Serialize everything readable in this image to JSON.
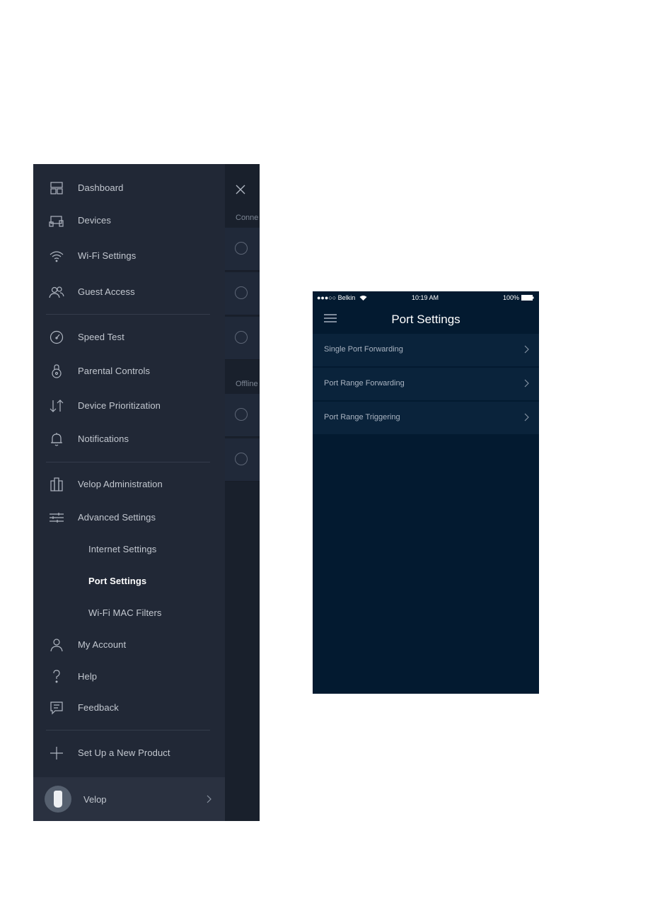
{
  "drawer": {
    "items": [
      {
        "label": "Dashboard",
        "icon": "dashboard-icon"
      },
      {
        "label": "Devices",
        "icon": "devices-icon"
      },
      {
        "label": "Wi-Fi Settings",
        "icon": "wifi-icon"
      },
      {
        "label": "Guest Access",
        "icon": "guest-access-icon"
      },
      {
        "label": "Speed Test",
        "icon": "speedometer-icon"
      },
      {
        "label": "Parental Controls",
        "icon": "lock-icon"
      },
      {
        "label": "Device Prioritization",
        "icon": "arrows-up-down-icon"
      },
      {
        "label": "Notifications",
        "icon": "bell-icon"
      },
      {
        "label": "Velop Administration",
        "icon": "velop-nodes-icon"
      },
      {
        "label": "Advanced Settings",
        "icon": "sliders-icon"
      },
      {
        "label": "My Account",
        "icon": "user-icon"
      },
      {
        "label": "Help",
        "icon": "question-icon"
      },
      {
        "label": "Feedback",
        "icon": "chat-icon"
      },
      {
        "label": "Set Up a New Product",
        "icon": "plus-icon"
      }
    ],
    "subitems": [
      {
        "label": "Internet Settings",
        "active": false
      },
      {
        "label": "Port Settings",
        "active": true
      },
      {
        "label": "Wi-Fi MAC Filters",
        "active": false
      }
    ],
    "footer": {
      "label": "Velop"
    }
  },
  "behind": {
    "connected_label": "Conne",
    "offline_label": "Offline"
  },
  "port_screen": {
    "status": {
      "carrier": "●●●○○ Belkin",
      "time": "10:19 AM",
      "battery": "100%"
    },
    "title": "Port Settings",
    "rows": [
      {
        "label": "Single Port Forwarding"
      },
      {
        "label": "Port Range Forwarding"
      },
      {
        "label": "Port Range Triggering"
      }
    ]
  },
  "colors": {
    "drawer_bg": "#212836",
    "port_bg": "#031a30",
    "port_row_bg": "#0a233b",
    "text_light": "#c3c8d0"
  }
}
